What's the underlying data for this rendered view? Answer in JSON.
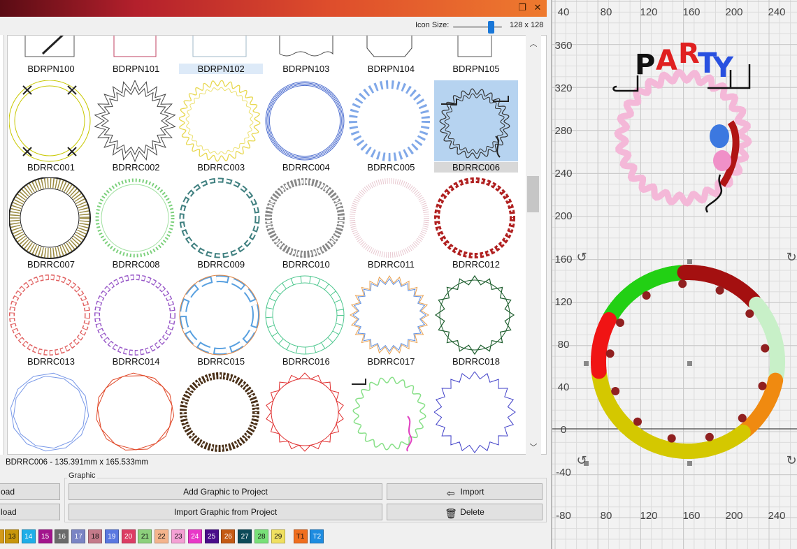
{
  "window": {
    "restore_glyph": "❐",
    "close_glyph": "✕"
  },
  "icon_size": {
    "label": "Icon Size:",
    "value": "128 x 128",
    "slider_level": 0.75
  },
  "grid": {
    "rows": [
      [
        "BDRPN100",
        "BDRPN101",
        "BDRPN102",
        "BDRPN103",
        "BDRPN104",
        "BDRPN105"
      ],
      [
        "BDRRC001",
        "BDRRC002",
        "BDRRC003",
        "BDRRC004",
        "BDRRC005",
        "BDRRC006"
      ],
      [
        "BDRRC007",
        "BDRRC008",
        "BDRRC009",
        "BDRRC010",
        "BDRRC011",
        "BDRRC012"
      ],
      [
        "BDRRC013",
        "BDRRC014",
        "BDRRC015",
        "BDRRC016",
        "BDRRC017",
        "BDRRC018"
      ]
    ],
    "selected": "BDRRC006",
    "highlighted": "BDRPN102"
  },
  "selection_info": "BDRRC006 - 135.391mm x 165.533mm",
  "left_buttons": {
    "load_1": "oad",
    "load_2": "load"
  },
  "graphic": {
    "group_label": "Graphic",
    "add_to_project": "Add Graphic to Project",
    "import_from_project": "Import Graphic from Project",
    "import": "Import",
    "delete": "Delete",
    "import_icon": "import-icon",
    "delete_icon": "trash-icon"
  },
  "palette": [
    {
      "label": "13",
      "color": "#c8960c"
    },
    {
      "label": "14",
      "color": "#1eaee8"
    },
    {
      "label": "15",
      "color": "#a2148c"
    },
    {
      "label": "16",
      "color": "#6a6a6a"
    },
    {
      "label": "17",
      "color": "#7a84c4"
    },
    {
      "label": "18",
      "color": "#c47a8a"
    },
    {
      "label": "19",
      "color": "#5a78e0"
    },
    {
      "label": "20",
      "color": "#dc3c64"
    },
    {
      "label": "21",
      "color": "#8cd07c"
    },
    {
      "label": "22",
      "color": "#f4b48c"
    },
    {
      "label": "23",
      "color": "#f4a0d4"
    },
    {
      "label": "24",
      "color": "#e838c8"
    },
    {
      "label": "25",
      "color": "#4a0c8a"
    },
    {
      "label": "26",
      "color": "#c45a14"
    },
    {
      "label": "27",
      "color": "#0c4a58"
    },
    {
      "label": "28",
      "color": "#78e078"
    },
    {
      "label": "29",
      "color": "#f0e060"
    },
    {
      "label": "T1",
      "color": "#f06e1e"
    },
    {
      "label": "T2",
      "color": "#1e8ce0"
    }
  ],
  "ruler": {
    "top": [
      "40",
      "80",
      "120",
      "160",
      "200",
      "240"
    ],
    "bottom": [
      "-80",
      "80",
      "120",
      "160",
      "200",
      "240"
    ],
    "left": [
      "360",
      "320",
      "280",
      "240",
      "200",
      "160",
      "120",
      "80",
      "40",
      "0",
      "-40"
    ]
  },
  "canvas_text": {
    "party": "PARTY"
  }
}
